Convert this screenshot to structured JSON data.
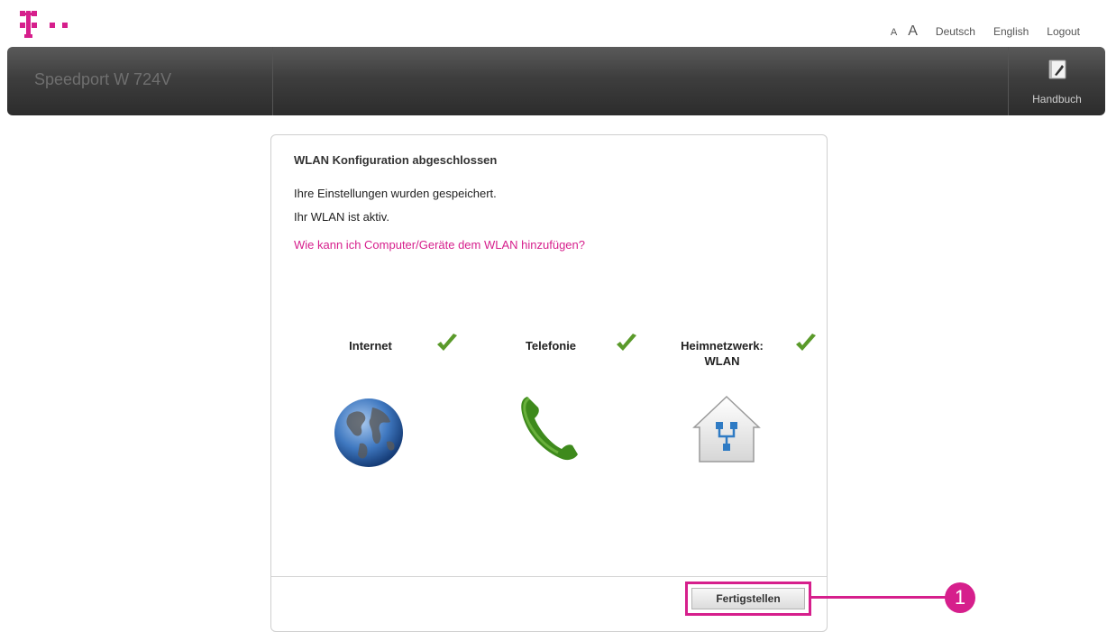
{
  "brand": {
    "magenta": "#d61f8c"
  },
  "header": {
    "font_small": "A",
    "font_large": "A",
    "lang_de": "Deutsch",
    "lang_en": "English",
    "logout": "Logout"
  },
  "topbar": {
    "title": "Speedport W 724V",
    "manual_label": "Handbuch",
    "manual_icon": "manual-icon"
  },
  "panel": {
    "title": "WLAN Konfiguration abgeschlossen",
    "line1": "Ihre Einstellungen wurden gespeichert.",
    "line2": "Ihr WLAN ist aktiv.",
    "help_link": "Wie kann ich Computer/Geräte dem WLAN hinzufügen?",
    "statuses": [
      {
        "label": "Internet",
        "icon": "globe-icon",
        "ok": true
      },
      {
        "label": "Telefonie",
        "icon": "phone-icon",
        "ok": true
      },
      {
        "label_line1": "Heimnetzwerk:",
        "label_line2": "WLAN",
        "icon": "home-network-icon",
        "ok": true
      }
    ],
    "finish_button": "Fertigstellen"
  },
  "callout": {
    "number": "1"
  }
}
